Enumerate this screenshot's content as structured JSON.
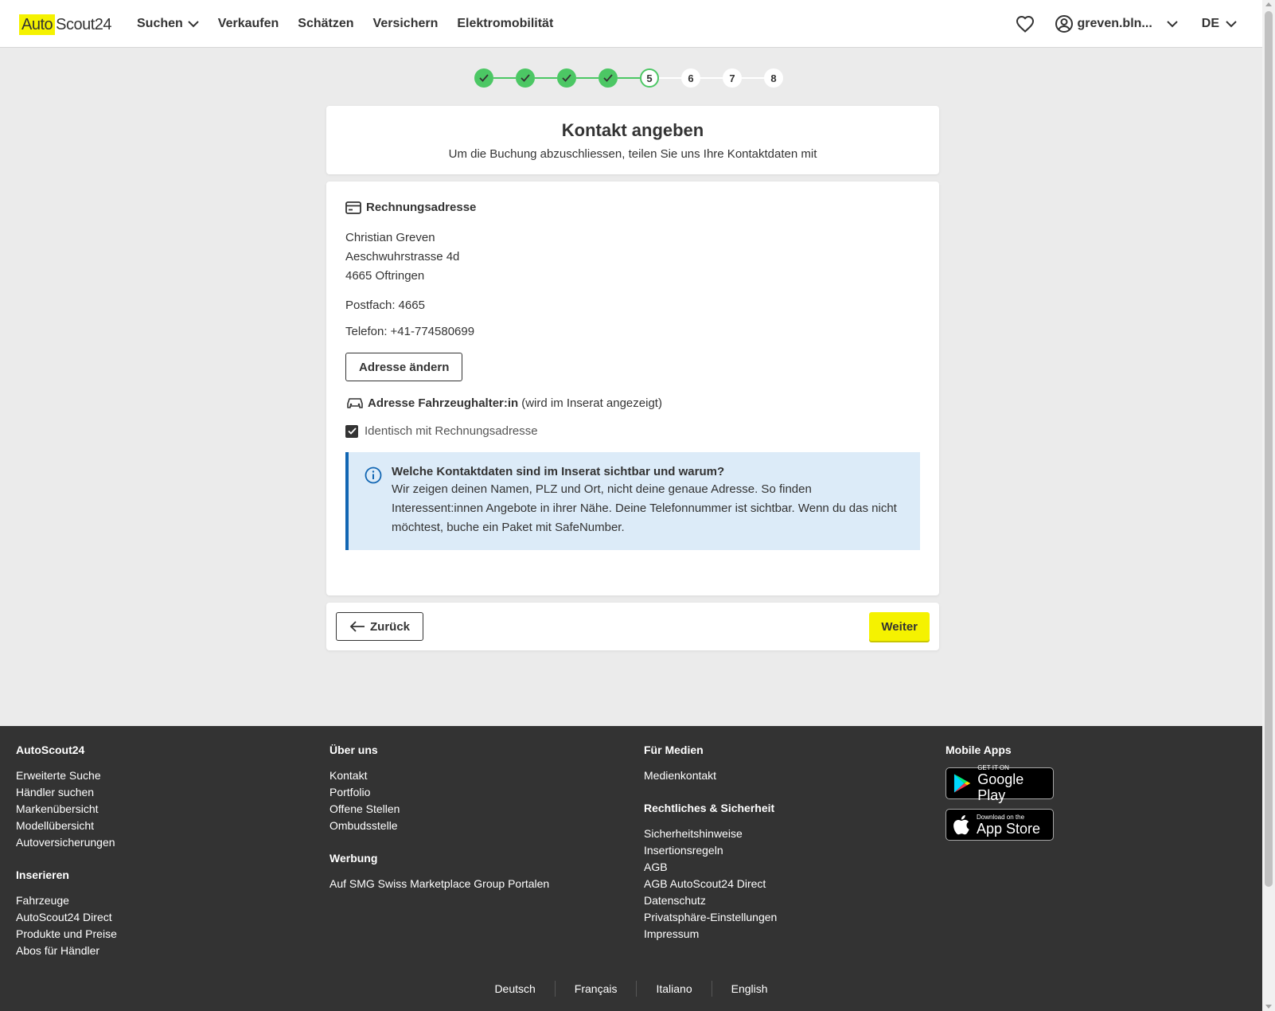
{
  "header": {
    "logo_auto": "Auto",
    "logo_scout": "Scout24",
    "nav": [
      "Suchen",
      "Verkaufen",
      "Schätzen",
      "Versichern",
      "Elektromobilität"
    ],
    "user": "greven.bln...",
    "lang": "DE"
  },
  "stepper": {
    "current": 5,
    "total": 8,
    "labels": [
      "5",
      "6",
      "7",
      "8"
    ]
  },
  "title_card": {
    "title": "Kontakt angeben",
    "subtitle": "Um die Buchung abzuschliessen, teilen Sie uns Ihre Kontaktdaten mit"
  },
  "billing": {
    "heading": "Rechnungsadresse",
    "name": "Christian Greven",
    "street": "Aeschwuhrstrasse 4d",
    "city": "4665 Oftringen",
    "postfach_label": "Postfach:",
    "postfach_value": "4665",
    "telefon_label": "Telefon:",
    "telefon_value": "+41-774580699",
    "change_button": "Adresse ändern"
  },
  "holder": {
    "heading": "Adresse Fahrzeughalter:in",
    "note": "(wird im Inserat angezeigt)",
    "checkbox_label": "Identisch mit Rechnungsadresse",
    "checkbox_checked": true
  },
  "info": {
    "title": "Welche Kontaktdaten sind im Inserat sichtbar und warum?",
    "text": "Wir zeigen deinen Namen, PLZ und Ort, nicht deine genaue Adresse. So finden Interessent:innen Angebote in ihrer Nähe. Deine Telefonnummer ist sichtbar. Wenn du das nicht möchtest, buche ein Paket mit SafeNumber."
  },
  "actions": {
    "back": "Zurück",
    "next": "Weiter"
  },
  "footer": {
    "col1": {
      "heading": "AutoScout24",
      "links": [
        "Erweiterte Suche",
        "Händler suchen",
        "Markenübersicht",
        "Modellübersicht",
        "Autoversicherungen"
      ],
      "heading2": "Inserieren",
      "links2": [
        "Fahrzeuge",
        "AutoScout24 Direct",
        "Produkte und Preise",
        "Abos für Händler"
      ]
    },
    "col2": {
      "heading": "Über uns",
      "links": [
        "Kontakt",
        "Portfolio",
        "Offene Stellen",
        "Ombudsstelle"
      ],
      "heading2": "Werbung",
      "links2": [
        "Auf SMG Swiss Marketplace Group Portalen"
      ]
    },
    "col3": {
      "heading": "Für Medien",
      "links": [
        "Medienkontakt"
      ],
      "heading2": "Rechtliches & Sicherheit",
      "links2": [
        "Sicherheitshinweise",
        "Insertionsregeln",
        "AGB",
        "AGB AutoScout24 Direct",
        "Datenschutz",
        "Privatsphäre-Einstellungen",
        "Impressum"
      ]
    },
    "col4": {
      "heading": "Mobile Apps",
      "google_small": "GET IT ON",
      "google_big": "Google Play",
      "apple_small": "Download on the",
      "apple_big": "App Store"
    },
    "languages": [
      "Deutsch",
      "Français",
      "Italiano",
      "English"
    ]
  },
  "colors": {
    "brand_yellow": "#f5f200",
    "success_green": "#4cc764",
    "info_blue": "#1166b3",
    "info_bg": "#dcebf8",
    "footer_bg": "#333333"
  }
}
